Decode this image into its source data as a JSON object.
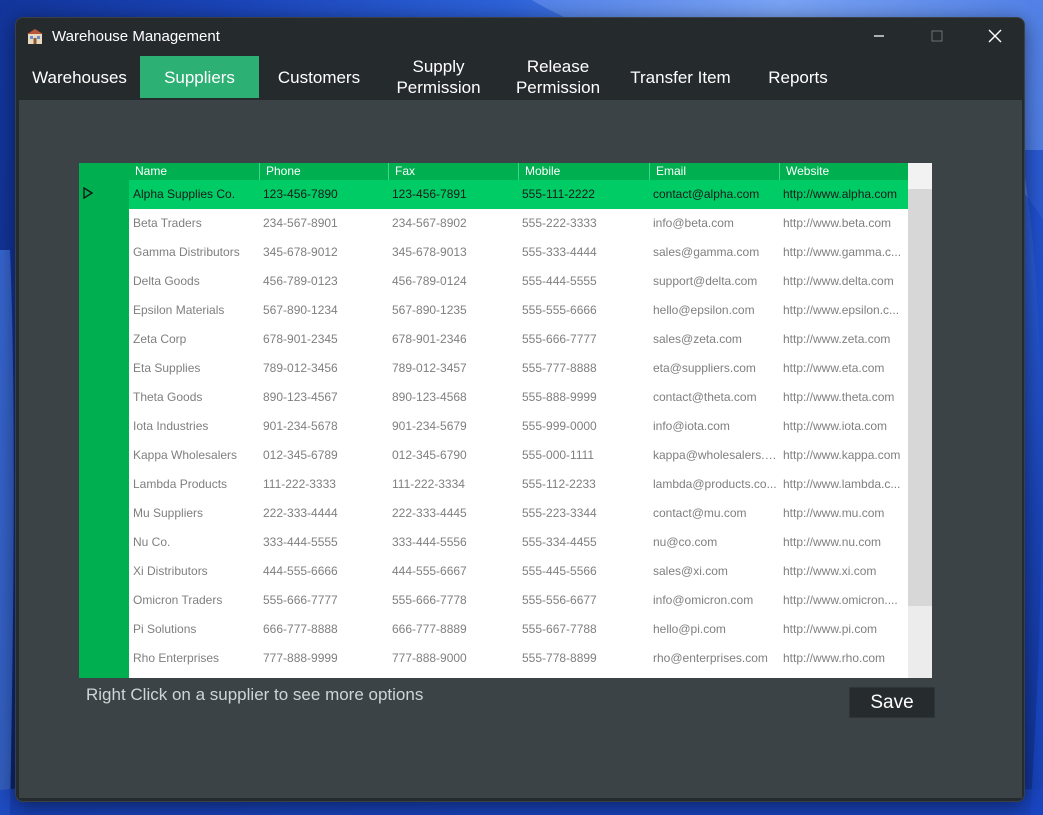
{
  "window": {
    "title": "Warehouse Management",
    "icons": {
      "app": "warehouse-icon",
      "minimize": "minimize-icon",
      "maximize": "maximize-icon",
      "close": "close-icon"
    }
  },
  "tabs": [
    {
      "label": "Warehouses",
      "active": false
    },
    {
      "label": "Suppliers",
      "active": true
    },
    {
      "label": "Customers",
      "active": false
    },
    {
      "label": "Supply\nPermission",
      "active": false
    },
    {
      "label": "Release\nPermission",
      "active": false
    },
    {
      "label": "Transfer Item",
      "active": false
    },
    {
      "label": "Reports",
      "active": false
    }
  ],
  "grid": {
    "columns": [
      "Name",
      "Phone",
      "Fax",
      "Mobile",
      "Email",
      "Website"
    ],
    "selected_row": 0,
    "rows": [
      [
        "Alpha Supplies Co.",
        "123-456-7890",
        "123-456-7891",
        "555-111-2222",
        "contact@alpha.com",
        "http://www.alpha.com"
      ],
      [
        "Beta Traders",
        "234-567-8901",
        "234-567-8902",
        "555-222-3333",
        "info@beta.com",
        "http://www.beta.com"
      ],
      [
        "Gamma Distributors",
        "345-678-9012",
        "345-678-9013",
        "555-333-4444",
        "sales@gamma.com",
        "http://www.gamma.c..."
      ],
      [
        "Delta Goods",
        "456-789-0123",
        "456-789-0124",
        "555-444-5555",
        "support@delta.com",
        "http://www.delta.com"
      ],
      [
        "Epsilon Materials",
        "567-890-1234",
        "567-890-1235",
        "555-555-6666",
        "hello@epsilon.com",
        "http://www.epsilon.c..."
      ],
      [
        "Zeta Corp",
        "678-901-2345",
        "678-901-2346",
        "555-666-7777",
        "sales@zeta.com",
        "http://www.zeta.com"
      ],
      [
        "Eta Supplies",
        "789-012-3456",
        "789-012-3457",
        "555-777-8888",
        "eta@suppliers.com",
        "http://www.eta.com"
      ],
      [
        "Theta Goods",
        "890-123-4567",
        "890-123-4568",
        "555-888-9999",
        "contact@theta.com",
        "http://www.theta.com"
      ],
      [
        "Iota Industries",
        "901-234-5678",
        "901-234-5679",
        "555-999-0000",
        "info@iota.com",
        "http://www.iota.com"
      ],
      [
        "Kappa Wholesalers",
        "012-345-6789",
        "012-345-6790",
        "555-000-1111",
        "kappa@wholesalers.c...",
        "http://www.kappa.com"
      ],
      [
        "Lambda Products",
        "111-222-3333",
        "111-222-3334",
        "555-112-2233",
        "lambda@products.co...",
        "http://www.lambda.c..."
      ],
      [
        "Mu Suppliers",
        "222-333-4444",
        "222-333-4445",
        "555-223-3344",
        "contact@mu.com",
        "http://www.mu.com"
      ],
      [
        "Nu Co.",
        "333-444-5555",
        "333-444-5556",
        "555-334-4455",
        "nu@co.com",
        "http://www.nu.com"
      ],
      [
        "Xi Distributors",
        "444-555-6666",
        "444-555-6667",
        "555-445-5566",
        "sales@xi.com",
        "http://www.xi.com"
      ],
      [
        "Omicron Traders",
        "555-666-7777",
        "555-666-7778",
        "555-556-6677",
        "info@omicron.com",
        "http://www.omicron...."
      ],
      [
        "Pi Solutions",
        "666-777-8888",
        "666-777-8889",
        "555-667-7788",
        "hello@pi.com",
        "http://www.pi.com"
      ],
      [
        "Rho Enterprises",
        "777-888-9999",
        "777-888-9000",
        "555-778-8899",
        "rho@enterprises.com",
        "http://www.rho.com"
      ]
    ],
    "icons": {
      "row_pointer": "row-pointer-icon"
    }
  },
  "footer": {
    "hint": "Right Click on a supplier to see more options",
    "save_label": "Save"
  },
  "colors": {
    "accent": "#2db074",
    "grid_header": "#00b050",
    "selected_row": "#00cc66",
    "window_bg": "#252a2c",
    "content_bg": "#3b4346"
  }
}
